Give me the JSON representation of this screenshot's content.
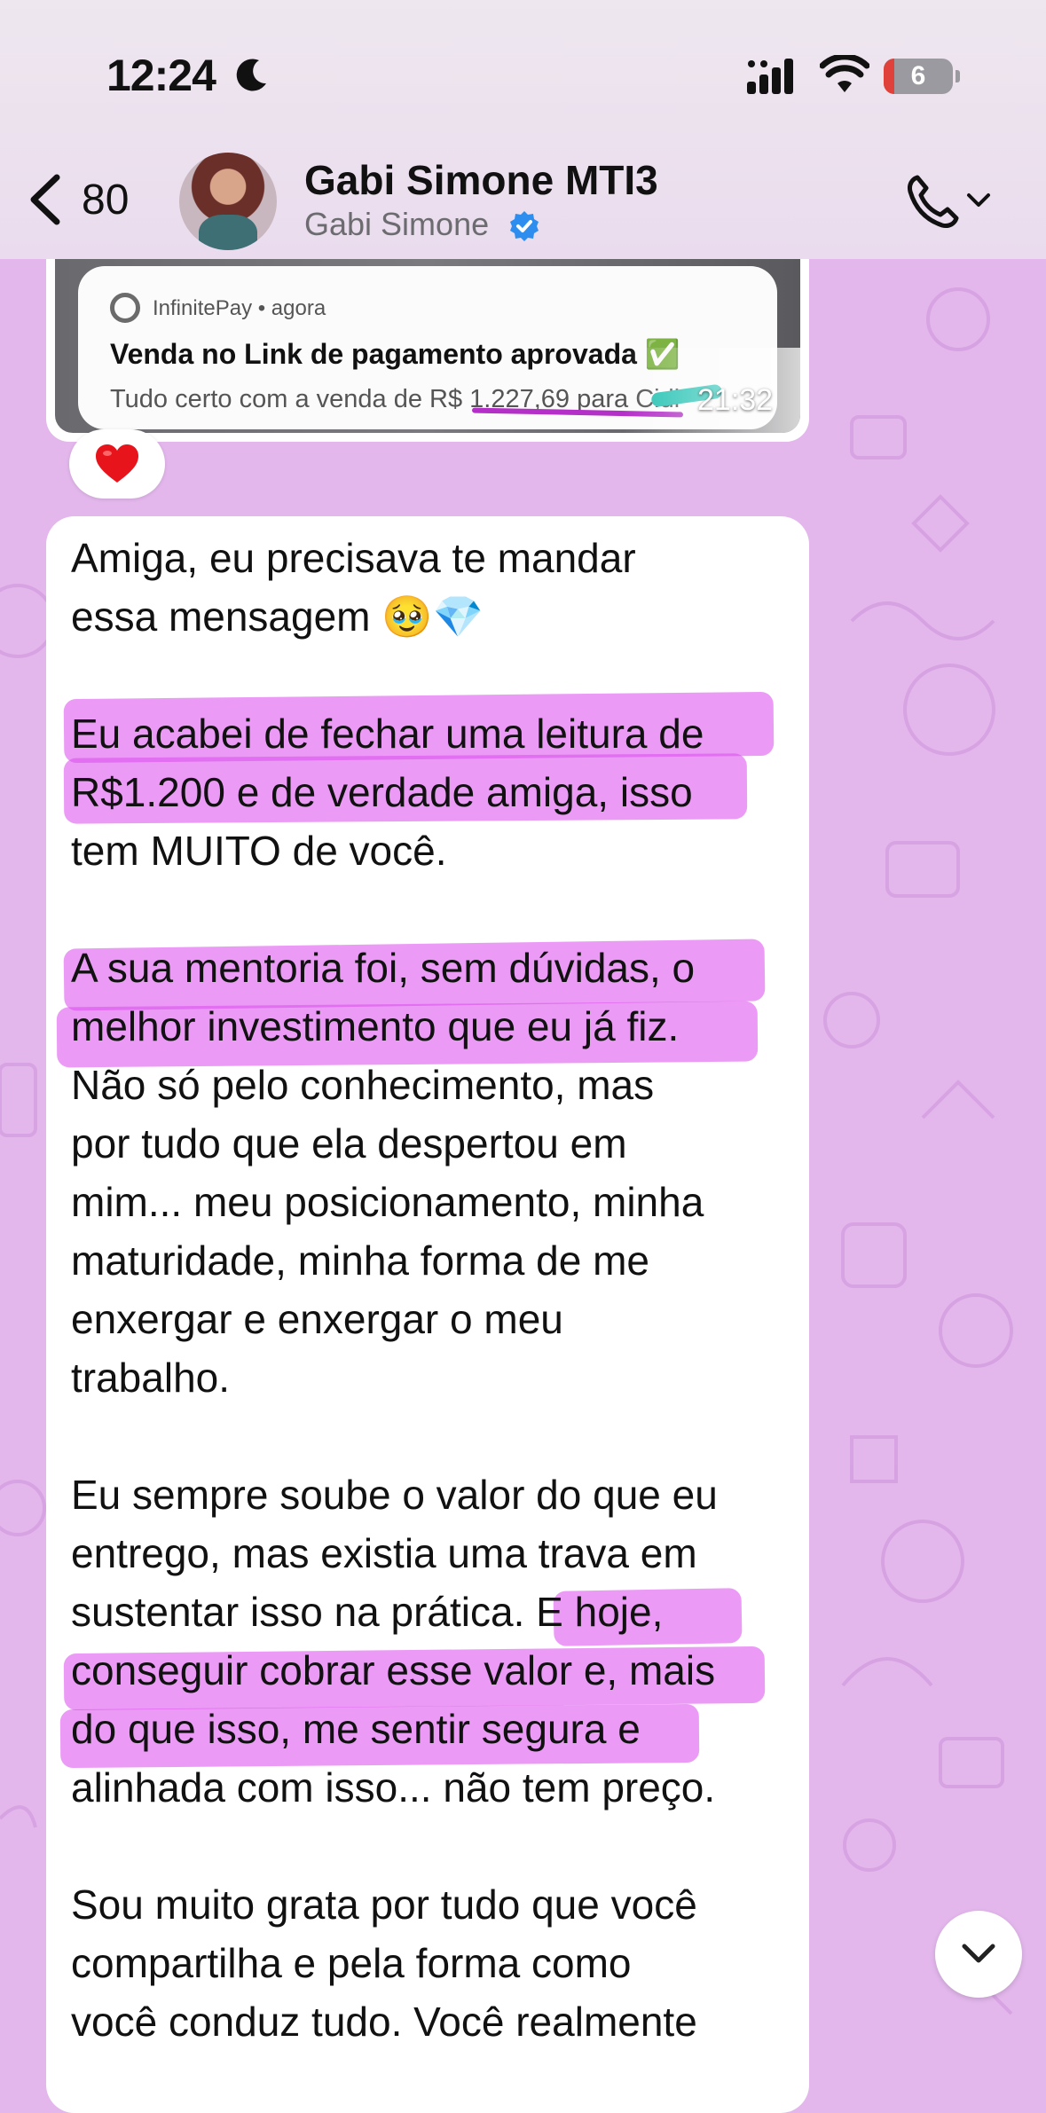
{
  "status_bar": {
    "time": "12:24",
    "battery": "6"
  },
  "header": {
    "back_count": "80",
    "contact_name": "Gabi Simone MTI3",
    "contact_subtitle": "Gabi Simone"
  },
  "image_message": {
    "notification": {
      "app": "InfinitePay • agora",
      "title": "Venda no Link de pagamento aprovada ✅",
      "body": "Tudo certo com a venda de R$ 1.227,69 para Cidi"
    },
    "time": "21:32",
    "reaction": "❤️"
  },
  "text_message": {
    "lines": [
      "Amiga, eu precisava te mandar",
      "essa mensagem 🥹💎",
      "",
      "Eu acabei de fechar uma leitura de",
      "R$1.200 e de  verdade amiga, isso",
      "tem MUITO de você.",
      "",
      "A sua mentoria foi, sem dúvidas, o",
      "melhor investimento que eu já fiz.",
      "Não só pelo conhecimento, mas",
      "por tudo que ela despertou em",
      "mim... meu posicionamento, minha",
      "maturidade, minha forma de me",
      "enxergar e enxergar o meu",
      "trabalho.",
      "",
      "Eu sempre soube o valor do que eu",
      "entrego, mas existia uma trava em",
      "sustentar isso na prática. E hoje,",
      "conseguir cobrar esse valor e, mais",
      "do que isso, me sentir segura e",
      "alinhada com isso... não tem preço.",
      "",
      "Sou muito grata por tudo que você",
      "compartilha e pela forma como",
      "você conduz tudo. Você realmente"
    ]
  },
  "colors": {
    "wallpaper": "#e3b7ec",
    "highlight": "#db48ec",
    "bubble": "#ffffff"
  }
}
